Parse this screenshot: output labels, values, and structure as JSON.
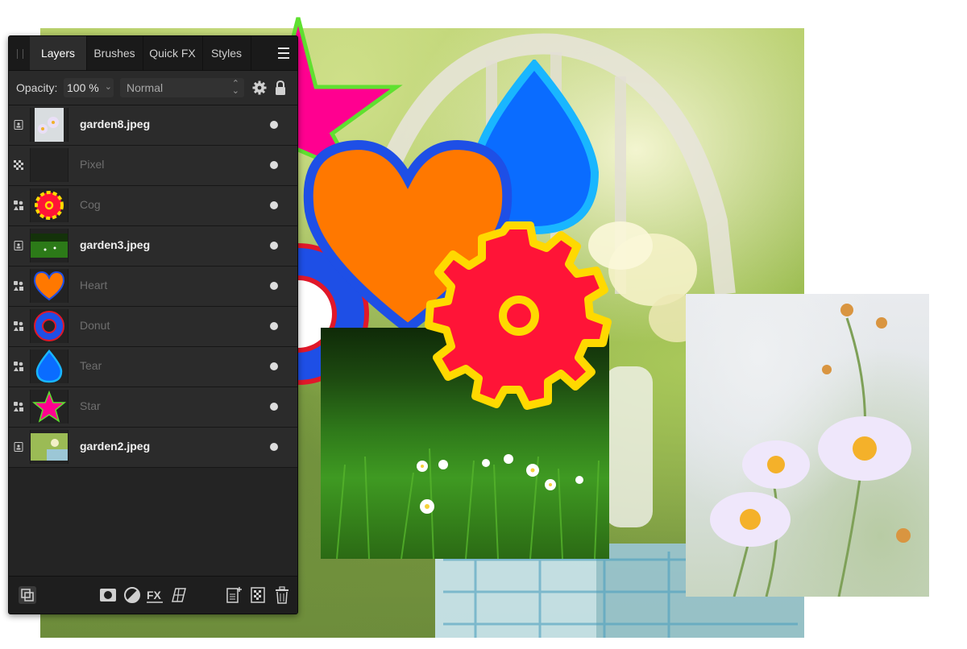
{
  "panel": {
    "tabs": [
      {
        "label": "Layers",
        "active": true
      },
      {
        "label": "Brushes",
        "active": false
      },
      {
        "label": "Quick FX",
        "active": false
      },
      {
        "label": "Styles",
        "active": false
      }
    ],
    "menu_icon": "hamburger-menu-icon"
  },
  "options": {
    "opacity_label": "Opacity:",
    "opacity_value": "100 %",
    "blend_mode": "Normal",
    "settings_icon": "gear-icon",
    "lock_icon": "lock-icon"
  },
  "layers": [
    {
      "name": "garden8.jpeg",
      "type": "image",
      "thumbnail": "flowers-photo",
      "visible": true
    },
    {
      "name": "Pixel",
      "type": "pixel",
      "thumbnail": "empty",
      "visible": true
    },
    {
      "name": "Cog",
      "type": "shape",
      "thumbnail": "cog-shape",
      "visible": true
    },
    {
      "name": "garden3.jpeg",
      "type": "image",
      "thumbnail": "grass-photo",
      "visible": true
    },
    {
      "name": "Heart",
      "type": "shape",
      "thumbnail": "heart-shape",
      "visible": true
    },
    {
      "name": "Donut",
      "type": "shape",
      "thumbnail": "donut-shape",
      "visible": true
    },
    {
      "name": "Tear",
      "type": "shape",
      "thumbnail": "tear-shape",
      "visible": true
    },
    {
      "name": "Star",
      "type": "shape",
      "thumbnail": "star-shape",
      "visible": true
    },
    {
      "name": "garden2.jpeg",
      "type": "image",
      "thumbnail": "garden-photo",
      "visible": true
    }
  ],
  "bottom_bar": {
    "left_icon": "layer-thumbnails-icon",
    "icons": [
      "mask-icon",
      "adjustment-icon",
      "fx-icon",
      "live-filter-icon",
      "add-layer-icon",
      "add-pixel-layer-icon",
      "trash-icon"
    ]
  },
  "colors": {
    "star_fill": "#ff0090",
    "star_stroke": "#5fe030",
    "heart_fill": "#ff7800",
    "heart_stroke": "#1e4fe6",
    "tear_fill": "#0a6cff",
    "tear_stroke": "#19b6ff",
    "cog_fill": "#ff1437",
    "cog_stroke": "#ffd900",
    "donut_fill": "#1e4fe6",
    "donut_stroke": "#e0182a",
    "panel_bg": "#242424"
  }
}
